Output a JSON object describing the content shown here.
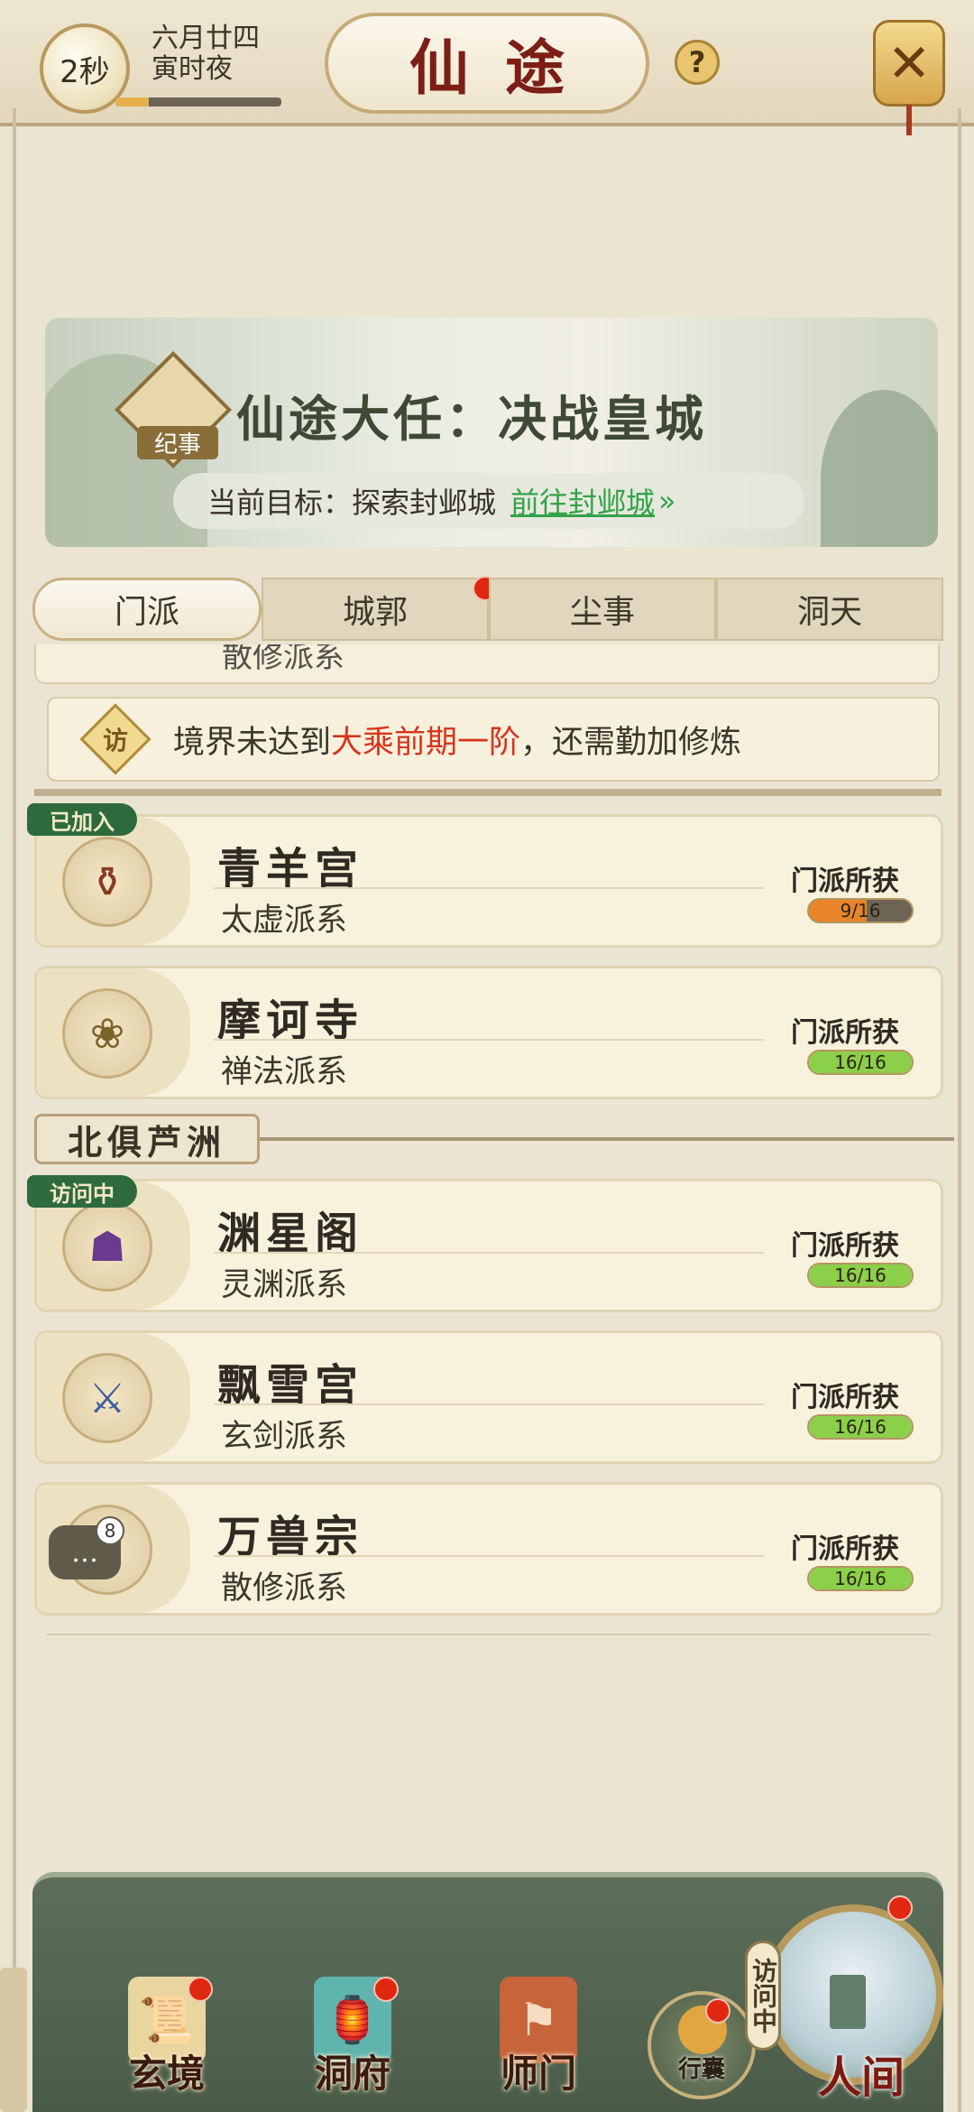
{
  "header": {
    "timer": "2秒",
    "date_line1": "六月廿四",
    "date_line2": "寅时夜",
    "time_progress": 0.2,
    "title": "仙途",
    "help_icon": "question-icon",
    "close_icon": "crossed-swords-close-icon"
  },
  "quest": {
    "badge_label": "纪事",
    "title": "仙途大任：决战皇城",
    "goal_prefix": "当前目标：探索封邺城",
    "goal_link": "前往封邺城",
    "goal_arrow": "»"
  },
  "tabs": [
    {
      "label": "门派",
      "active": true
    },
    {
      "label": "城郭",
      "has_dot": true
    },
    {
      "label": "尘事"
    },
    {
      "label": "洞天"
    }
  ],
  "partial_card_branch": "散修派系",
  "notice": {
    "icon_label": "访",
    "text_before": "境界未达到",
    "highlight": "大乘前期一阶",
    "text_after": "，还需勤加修炼"
  },
  "sects_top": [
    {
      "badge": "已加入",
      "name": "青羊宫",
      "branch": "太虚派系",
      "gain_label": "门派所获",
      "progress": "9/16",
      "ratio": 0.5625,
      "bar_color": "#e8852a",
      "emblem_icon": "cauldron-icon"
    },
    {
      "name": "摩诃寺",
      "branch": "禅法派系",
      "gain_label": "门派所获",
      "progress": "16/16",
      "ratio": 1.0,
      "bar_color": "#8bcf4a",
      "emblem_icon": "lotus-icon"
    }
  ],
  "region": "北俱芦洲",
  "sects_north": [
    {
      "badge": "访问中",
      "name": "渊星阁",
      "branch": "灵渊派系",
      "gain_label": "门派所获",
      "progress": "16/16",
      "ratio": 1.0,
      "bar_color": "#8bcf4a",
      "emblem_icon": "demon-mask-icon"
    },
    {
      "name": "飘雪宫",
      "branch": "玄剑派系",
      "gain_label": "门派所获",
      "progress": "16/16",
      "ratio": 1.0,
      "bar_color": "#8bcf4a",
      "emblem_icon": "sword-icon"
    },
    {
      "name": "万兽宗",
      "branch": "散修派系",
      "gain_label": "门派所获",
      "progress": "16/16",
      "ratio": 1.0,
      "bar_color": "#8bcf4a",
      "emblem_icon": "beast-icon"
    }
  ],
  "chat": {
    "icon": "chat-bubble-icon",
    "count": "8"
  },
  "bottom_nav": {
    "items": [
      {
        "label": "玄境",
        "icon": "scroll-icon"
      },
      {
        "label": "洞府",
        "icon": "lantern-icon"
      },
      {
        "label": "师门",
        "icon": "banner-icon"
      }
    ],
    "bag_label": "行囊",
    "world_label": "人间",
    "visiting_tag": "访问中"
  }
}
